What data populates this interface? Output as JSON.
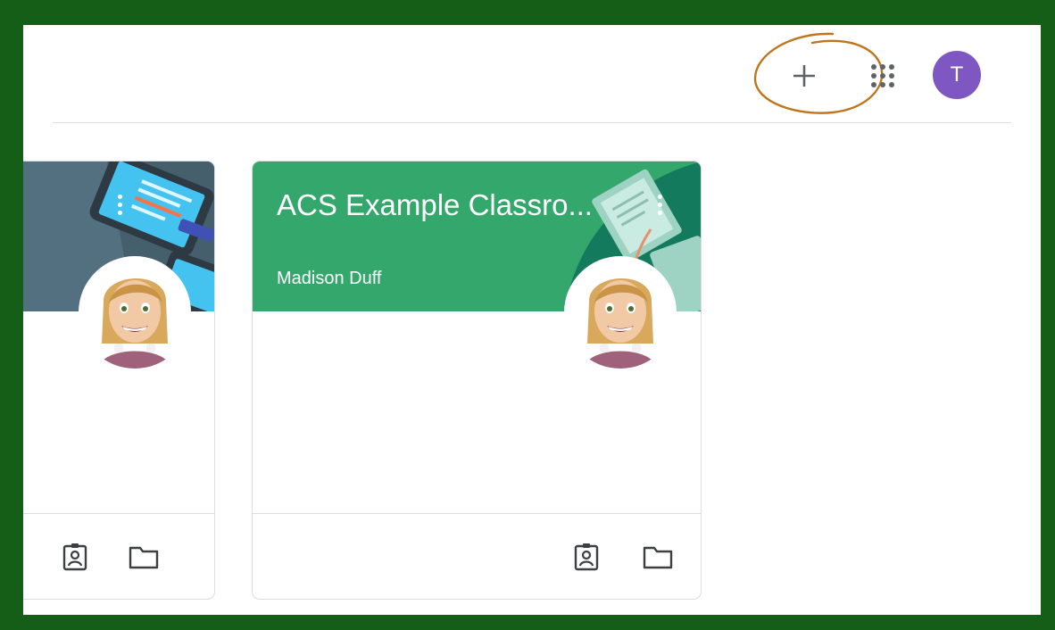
{
  "topbar": {
    "add_icon": "plus-icon",
    "apps_icon": "google-apps-grid-icon",
    "account_initial": "T",
    "account_color": "#7e57c2",
    "annotation_color": "#c0751d"
  },
  "classes": [
    {
      "title": "",
      "teacher": "",
      "header_color": "#5f7d8c",
      "icons": [
        "assignment-ind-icon",
        "folder-icon"
      ]
    },
    {
      "title": "ACS Example Classro...",
      "teacher": "Madison Duff",
      "header_color": "#34a86c",
      "accent_color": "#147a5d",
      "icons": [
        "assignment-ind-icon",
        "folder-icon"
      ]
    }
  ],
  "colors": {
    "frame_border": "#155e17",
    "divider": "#dadce0",
    "icon_gray": "#5f6368"
  }
}
